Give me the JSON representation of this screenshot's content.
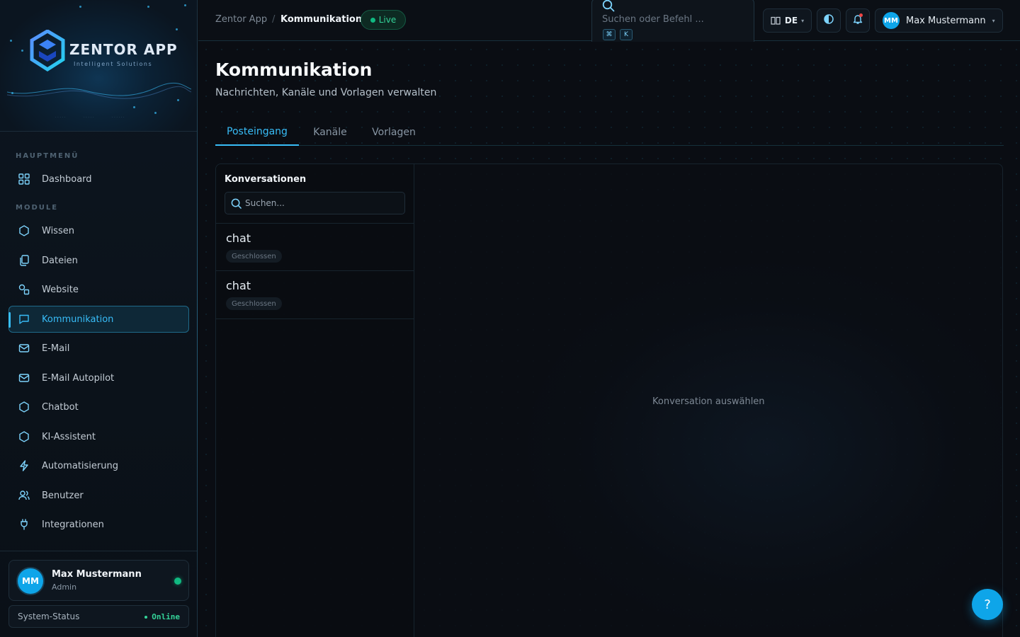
{
  "brand": {
    "name": "ZENTOR APP",
    "tagline": "Intelligent Solutions"
  },
  "sidebar": {
    "sections": {
      "main": "HAUPTMENÜ",
      "modules": "MODULE"
    },
    "items": [
      {
        "label": "Dashboard",
        "icon": "grid-icon"
      },
      {
        "label": "Wissen",
        "icon": "hexagon-icon"
      },
      {
        "label": "Dateien",
        "icon": "files-icon"
      },
      {
        "label": "Website",
        "icon": "shapes-icon"
      },
      {
        "label": "Kommunikation",
        "icon": "message-icon",
        "active": true
      },
      {
        "label": "E-Mail",
        "icon": "mail-icon"
      },
      {
        "label": "E-Mail Autopilot",
        "icon": "mail-icon"
      },
      {
        "label": "Chatbot",
        "icon": "hexagon-icon"
      },
      {
        "label": "KI-Assistent",
        "icon": "hexagon-icon"
      },
      {
        "label": "Automatisierung",
        "icon": "bolt-icon"
      },
      {
        "label": "Benutzer",
        "icon": "users-icon"
      },
      {
        "label": "Integrationen",
        "icon": "plug-icon"
      }
    ],
    "user": {
      "initials": "MM",
      "name": "Max Mustermann",
      "role": "Admin"
    },
    "status": {
      "label": "System-Status",
      "value": "Online"
    }
  },
  "topbar": {
    "breadcrumb": {
      "root": "Zentor App",
      "separator": "/",
      "current": "Kommunikation"
    },
    "live_label": "Live",
    "search": {
      "placeholder": "Suchen oder Befehl ...",
      "shortcut": [
        "⌘",
        "K"
      ]
    },
    "language": "DE",
    "user": {
      "initials": "MM",
      "name": "Max Mustermann"
    }
  },
  "page": {
    "title": "Kommunikation",
    "subtitle": "Nachrichten, Kanäle und Vorlagen verwalten",
    "tabs": [
      {
        "label": "Posteingang",
        "active": true
      },
      {
        "label": "Kanäle"
      },
      {
        "label": "Vorlagen"
      }
    ]
  },
  "conversations": {
    "title": "Konversationen",
    "search_placeholder": "Suchen...",
    "items": [
      {
        "name": "chat",
        "status": "Geschlossen"
      },
      {
        "name": "chat",
        "status": "Geschlossen"
      }
    ],
    "empty_message": "Konversation auswählen"
  },
  "help": {
    "label": "?"
  },
  "colors": {
    "accent": "#38bdf8",
    "online": "#10b981",
    "background": "#0a0d13"
  }
}
